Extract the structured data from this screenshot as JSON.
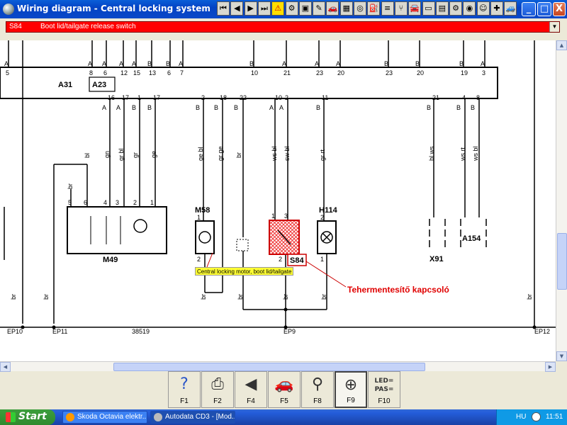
{
  "window": {
    "title": "Wiring diagram - Central locking system",
    "toolbar_icons": [
      "first-page-icon",
      "previous-page-icon",
      "next-page-icon",
      "last-page-icon",
      "warning-icon",
      "gear-icon",
      "image-icon",
      "settings-icon",
      "car-icon",
      "chip-icon",
      "wheel-icon",
      "fuel-icon",
      "rack-icon",
      "seat-icon",
      "car-front-icon",
      "window-icon",
      "monitor-icon",
      "engine-icon",
      "sensor-icon",
      "person-icon",
      "diagnostics-icon",
      "car-side-icon"
    ],
    "buttons": {
      "minimize": "_",
      "maximize": "□",
      "close": "X"
    }
  },
  "component_select": {
    "code": "S84",
    "name": "Boot lid/tailgate release switch"
  },
  "diagram": {
    "top_pins": [
      {
        "letter": "A",
        "num": "5"
      },
      {
        "letter": "A",
        "num": "8"
      },
      {
        "letter": "A",
        "num": "6"
      },
      {
        "letter": "A",
        "num": "12"
      },
      {
        "letter": "A",
        "num": "15"
      },
      {
        "letter": "B",
        "num": "13"
      },
      {
        "letter": "B",
        "num": "6"
      },
      {
        "letter": "A",
        "num": "7"
      },
      {
        "letter": "B",
        "num": "10"
      },
      {
        "letter": "A",
        "num": "21"
      },
      {
        "letter": "A",
        "num": "23"
      },
      {
        "letter": "A",
        "num": "20"
      },
      {
        "letter": "B",
        "num": "23"
      },
      {
        "letter": "B",
        "num": "20"
      },
      {
        "letter": "B",
        "num": "19"
      },
      {
        "letter": "A",
        "num": "3"
      }
    ],
    "bottom_pins": [
      {
        "letter": "A",
        "num": "16"
      },
      {
        "letter": "A",
        "num": "17"
      },
      {
        "letter": "B",
        "num": "1"
      },
      {
        "letter": "B",
        "num": "17"
      },
      {
        "letter": "B",
        "num": "2"
      },
      {
        "letter": "B",
        "num": "18"
      },
      {
        "letter": "B",
        "num": "22"
      },
      {
        "letter": "A",
        "num": "10"
      },
      {
        "letter": "A",
        "num": "2"
      },
      {
        "letter": "B",
        "num": "11"
      },
      {
        "letter": "B",
        "num": "21"
      },
      {
        "letter": "B",
        "num": "4"
      },
      {
        "letter": "B",
        "num": "8"
      }
    ],
    "control_unit": "A31",
    "sub_unit": "A23",
    "wire_colors": [
      "bl",
      "gn",
      "gr bl",
      "gr",
      "ge",
      "br",
      "ge bl",
      "gr ge",
      "br",
      "ws bl",
      "sw bl",
      "gr rt",
      "bl ws",
      "ws rt",
      "ws bl",
      "br",
      "br",
      "br",
      "br",
      "br",
      "br",
      "br"
    ],
    "components": {
      "m49": "M49",
      "m49_pins": [
        "5",
        "6",
        "4",
        "3",
        "2",
        "1"
      ],
      "m58": "M58",
      "m58_pins": [
        "1",
        "2"
      ],
      "s84": "S84",
      "s84_pins": [
        "1",
        "3",
        "2"
      ],
      "h114": "H114",
      "h114_pins": [
        "2",
        "1"
      ],
      "x91": "X91",
      "a154": "A154"
    },
    "ground_points": [
      "EP10",
      "EP11",
      "38519",
      "EP9",
      "EP12"
    ],
    "tooltip": "Central locking motor, boot lid/tailgate",
    "annotation": "Tehermentesítő kapcsoló"
  },
  "fkeys": [
    {
      "label": "F1",
      "icon": "help-icon",
      "glyph": "?"
    },
    {
      "label": "F2",
      "icon": "print-icon",
      "glyph": "⎙"
    },
    {
      "label": "F4",
      "icon": "back-icon",
      "glyph": "◀"
    },
    {
      "label": "F5",
      "icon": "car-search-icon",
      "glyph": "🚗"
    },
    {
      "label": "F8",
      "icon": "diagnostic-icon",
      "glyph": "⚲"
    },
    {
      "label": "F9",
      "icon": "component-locate-icon",
      "glyph": "⊕"
    },
    {
      "label": "F10",
      "icon": "led-pas-icon",
      "glyph": "LED=\nPAS="
    }
  ],
  "taskbar": {
    "start": "Start",
    "tasks": [
      "Skoda Octavia elektr...",
      "Autodata CD3 - [Mod..."
    ],
    "lang": "HU",
    "clock": "11:51"
  }
}
